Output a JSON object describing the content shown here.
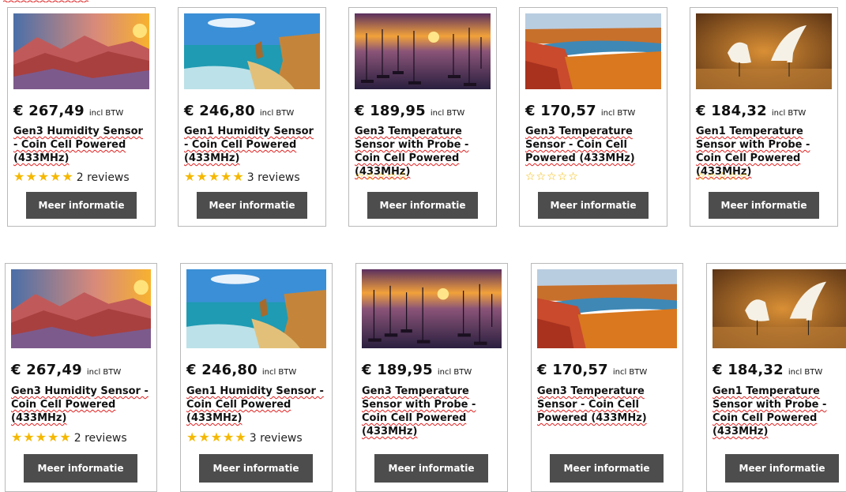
{
  "products_row1": [
    {
      "price": "€ 267,49",
      "price_note": "incl BTW",
      "title": "Gen3 Humidity Sensor - Coin Cell Powered (433MHz)",
      "stars": "★★★★★",
      "rating_style": "full",
      "reviews": "2 reviews",
      "button": "Meer informatie",
      "image": "rainbow-mountains"
    },
    {
      "price": "€ 246,80",
      "price_note": "incl BTW",
      "title": "Gen1 Humidity Sensor - Coin Cell Powered (433MHz)",
      "stars": "★★★★★",
      "rating_style": "full",
      "reviews": "3 reviews",
      "button": "Meer informatie",
      "image": "coastal-cliffs"
    },
    {
      "price": "€ 189,95",
      "price_note": "incl BTW",
      "title": "Gen3 Temperature Sensor with Probe - Coin Cell Powered (433MHz)",
      "stars": "☆☆☆☆☆",
      "rating_style": "empty",
      "reviews": "",
      "button": "Meer informatie",
      "image": "harbor-sunset"
    },
    {
      "price": "€ 170,57",
      "price_note": "incl BTW",
      "title": "Gen3 Temperature Sensor - Coin Cell Powered (433MHz)",
      "stars": "☆☆☆☆☆",
      "rating_style": "empty",
      "reviews": "",
      "button": "Meer informatie",
      "image": "autumn-lake"
    },
    {
      "price": "€ 184,32",
      "price_note": "incl BTW",
      "title": "Gen1 Temperature Sensor with Probe - Coin Cell Powered (433MHz)",
      "stars": "☆☆☆☆☆",
      "rating_style": "empty",
      "reviews": "",
      "button": "Meer informatie",
      "image": "egrets"
    }
  ],
  "products_row2": [
    {
      "price": "€ 267,49",
      "price_note": "incl BTW",
      "title": "Gen3 Humidity Sensor - Coin Cell Powered (433MHz)",
      "stars": "★★★★★",
      "rating_style": "full",
      "reviews": "2 reviews",
      "button": "Meer informatie",
      "image": "rainbow-mountains"
    },
    {
      "price": "€ 246,80",
      "price_note": "incl BTW",
      "title": "Gen1 Humidity Sensor - Coin Cell Powered (433MHz)",
      "stars": "★★★★★",
      "rating_style": "full",
      "reviews": "3 reviews",
      "button": "Meer informatie",
      "image": "coastal-cliffs"
    },
    {
      "price": "€ 189,95",
      "price_note": "incl BTW",
      "title": "Gen3 Temperature Sensor with Probe - Coin Cell Powered (433MHz)",
      "stars": "",
      "rating_style": "none",
      "reviews": "",
      "button": "Meer informatie",
      "image": "harbor-sunset"
    },
    {
      "price": "€ 170,57",
      "price_note": "incl BTW",
      "title": "Gen3 Temperature Sensor - Coin Cell Powered (433MHz)",
      "stars": "",
      "rating_style": "none",
      "reviews": "",
      "button": "Meer informatie",
      "image": "autumn-lake"
    },
    {
      "price": "€ 184,32",
      "price_note": "incl BTW",
      "title": "Gen1 Temperature Sensor with Probe - Coin Cell Powered (433MHz)",
      "stars": "",
      "rating_style": "none",
      "reviews": "",
      "button": "Meer informatie",
      "image": "egrets"
    }
  ],
  "colors": {
    "button_bg": "#4d4d4d",
    "star": "#f5b800",
    "spellcheck_underline": "#e02020",
    "card_border": "#b9b9b9"
  }
}
